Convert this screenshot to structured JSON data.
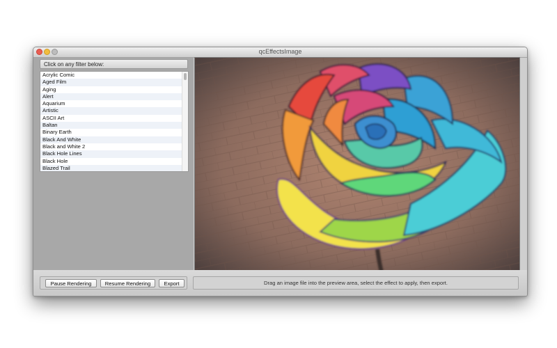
{
  "window": {
    "title": "qcEffectsImage"
  },
  "filter_panel": {
    "header": "Click on any filter below:",
    "filters": [
      "Acrylic Comic",
      "Aged Film",
      "Aging",
      "Alert",
      "Aquarium",
      "Artistic",
      "ASCII Art",
      "Baltan",
      "Binary Earth",
      "Black And White",
      "Black and White 2",
      "Black Hole Lines",
      "Black Hole",
      "Blazed Trail"
    ]
  },
  "buttons": {
    "pause": "Pause Rendering",
    "resume": "Resume Rendering",
    "export": "Export"
  },
  "status": {
    "message": "Drag an image file into the preview area, select the effect to apply, then export."
  },
  "colors": {
    "close": "#ea5d52",
    "minimize": "#f2bd3f",
    "zoom": "#bdbdbd"
  }
}
